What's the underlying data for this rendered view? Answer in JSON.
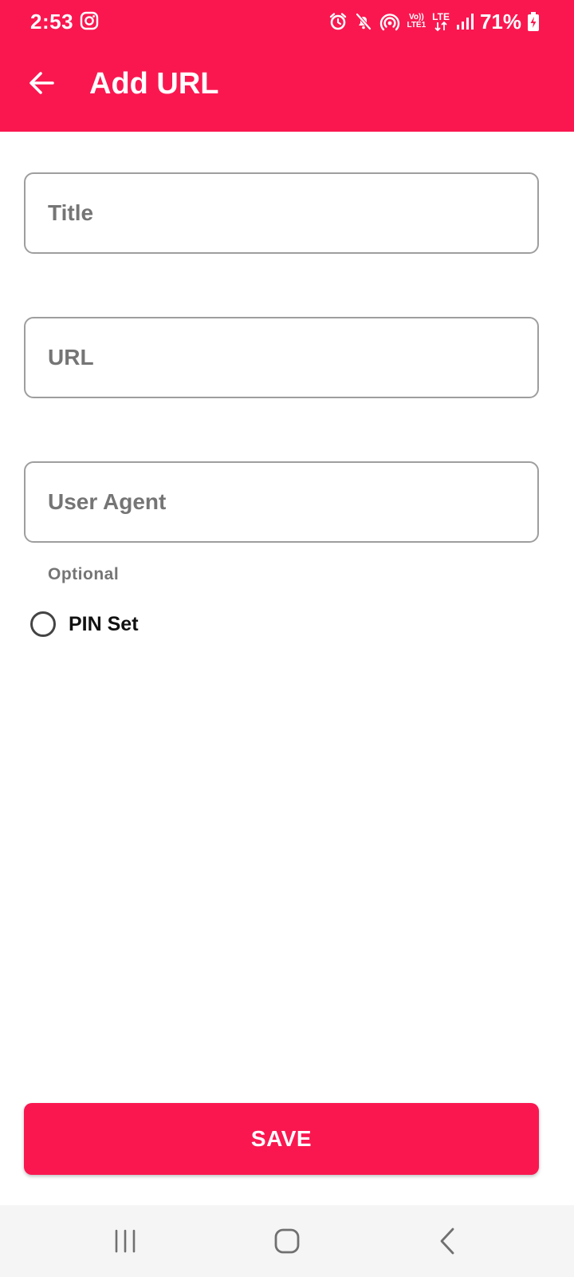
{
  "status_bar": {
    "time": "2:53",
    "network_top": "Vo))",
    "network_bottom": "LTE1",
    "lte_label": "LTE",
    "battery_percent": "71%",
    "icons": [
      "instagram-icon",
      "alarm-icon",
      "mute-icon",
      "hotspot-icon",
      "volte-icon",
      "lte-data-icon",
      "signal-icon",
      "battery-charging-icon"
    ]
  },
  "appbar": {
    "title": "Add URL",
    "back_icon": "arrow-back-icon"
  },
  "form": {
    "title_placeholder": "Title",
    "url_placeholder": "URL",
    "user_agent_placeholder": "User Agent",
    "user_agent_helper": "Optional",
    "pin_label": "PIN Set",
    "pin_checked": false
  },
  "save_label": "SAVE",
  "nav": {
    "icons": [
      "recent-apps-icon",
      "home-icon",
      "back-icon"
    ]
  },
  "colors": {
    "accent": "#fa1750",
    "outline": "#9e9e9e",
    "helper_text": "#757575",
    "nav_background": "#f5f5f5"
  }
}
